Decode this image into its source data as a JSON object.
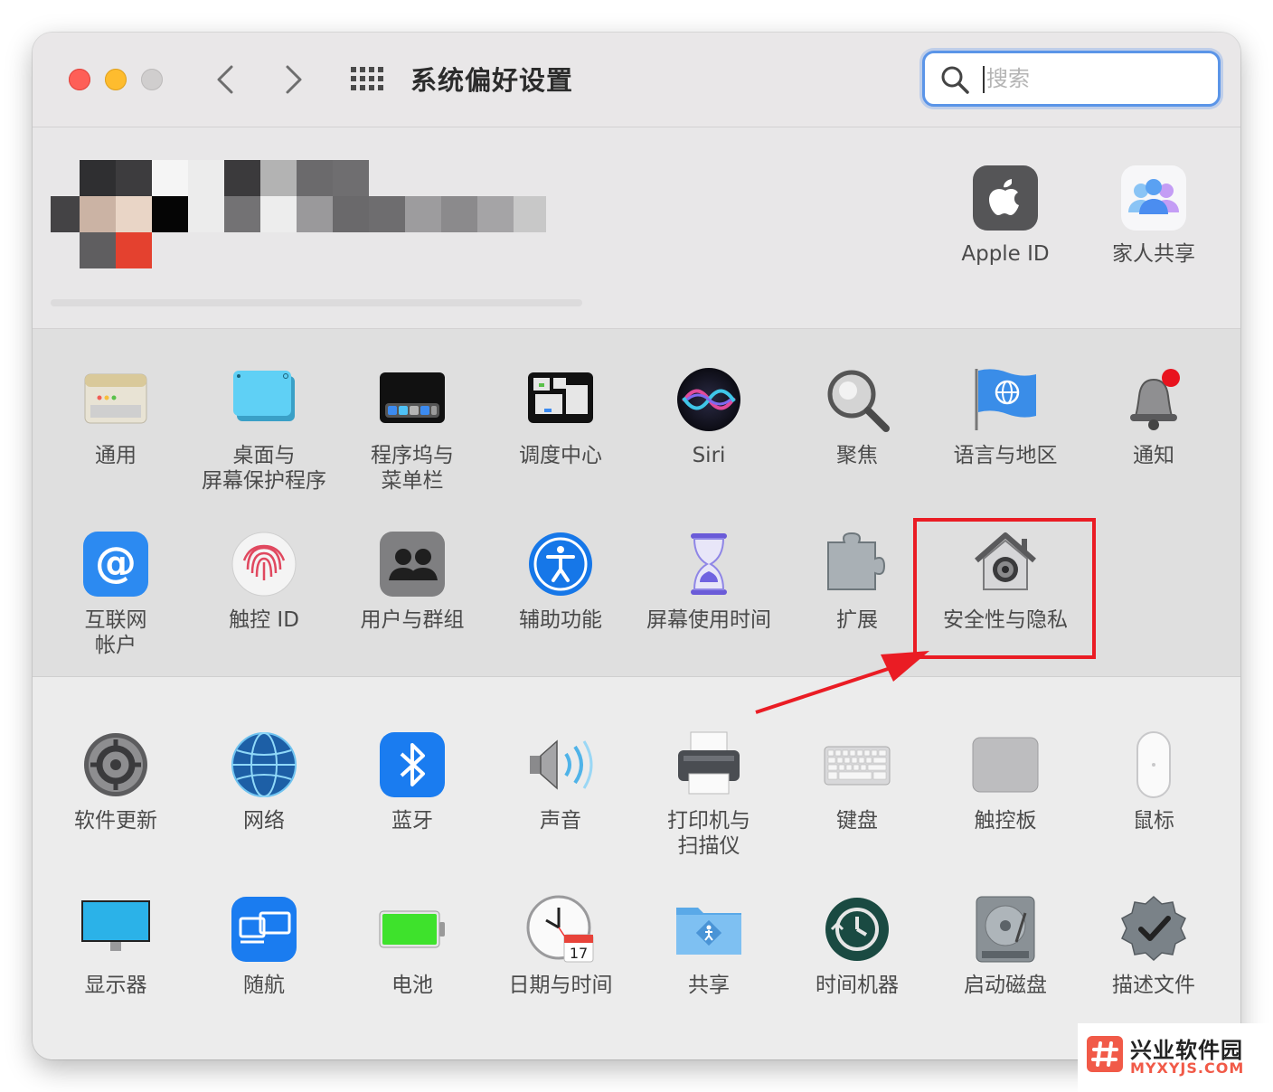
{
  "window": {
    "title": "系统偏好设置",
    "search_placeholder": "搜索"
  },
  "account": {
    "apple_id_label": "Apple ID",
    "family_label": "家人共享"
  },
  "prefs_row1": [
    "通用",
    "桌面与\n屏幕保护程序",
    "程序坞与\n菜单栏",
    "调度中心",
    "Siri",
    "聚焦",
    "语言与地区",
    "通知"
  ],
  "prefs_row2": [
    "互联网\n帐户",
    "触控 ID",
    "用户与群组",
    "辅助功能",
    "屏幕使用时间",
    "扩展",
    "安全性与隐私"
  ],
  "prefs_row3": [
    "软件更新",
    "网络",
    "蓝牙",
    "声音",
    "打印机与\n扫描仪",
    "键盘",
    "触控板",
    "鼠标"
  ],
  "prefs_row4": [
    "显示器",
    "随航",
    "电池",
    "日期与时间",
    "共享",
    "时间机器",
    "启动磁盘",
    "描述文件"
  ],
  "watermark": {
    "name": "兴业软件园",
    "url": "MYXYJS.COM"
  },
  "colors": {
    "highlight": "#ea1c24",
    "search_border": "#5b95e8"
  }
}
